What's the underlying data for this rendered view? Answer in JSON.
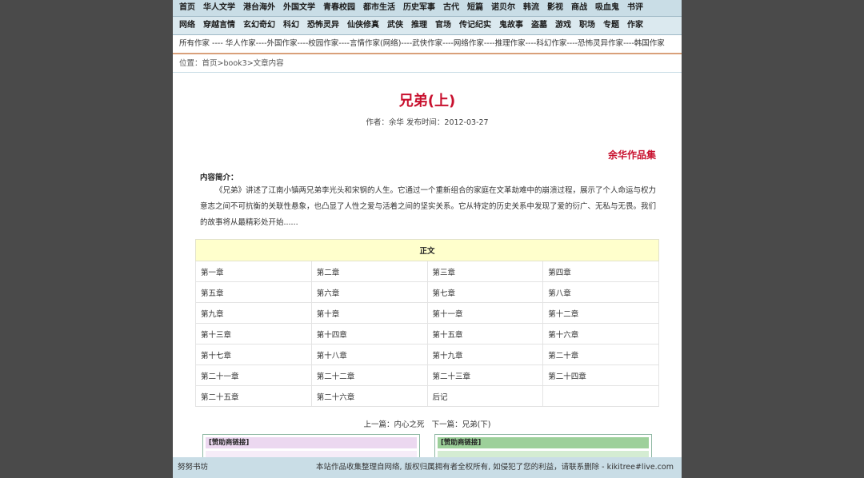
{
  "nav": {
    "row1": [
      "首页",
      "华人文学",
      "港台海外",
      "外国文学",
      "青春校园",
      "都市生活",
      "历史军事",
      "古代",
      "短篇",
      "诺贝尔",
      "韩流",
      "影视",
      "商战",
      "吸血鬼",
      "书评"
    ],
    "row2": [
      "网络",
      "穿越言情",
      "玄幻奇幻",
      "科幻",
      "恐怖灵异",
      "仙侠修真",
      "武侠",
      "推理",
      "官场",
      "传记纪实",
      "鬼故事",
      "盗墓",
      "游戏",
      "职场",
      "专题",
      "作家"
    ]
  },
  "author_links": [
    "所有作家",
    "华人作家",
    "外国作家",
    "校园作家",
    "言情作家(网络)",
    "武侠作家",
    "网络作家",
    "推理作家",
    "科幻作家",
    "恐怖灵异作家",
    "韩国作家"
  ],
  "author_separators": [
    " ---- ",
    "----",
    "----",
    "----",
    "----",
    "----",
    "----",
    "----",
    "----",
    "----"
  ],
  "breadcrumb": {
    "label": "位置：",
    "home": "首页",
    "sep1": ">",
    "book": "book3",
    "sep2": ">",
    "current": "文章内容"
  },
  "article": {
    "title": "兄弟(上)",
    "meta": "作者：余华 发布时间：2012-03-27",
    "collection": "余华作品集",
    "intro_label": "内容简介：",
    "intro_text": "《兄弟》讲述了江南小镇两兄弟李光头和宋钢的人生。它通过一个重新组合的家庭在文革劫难中的崩溃过程，展示了个人命运与权力意志之间不可抗衡的关联性悬象，也凸显了人性之爱与活着之间的坚实关系。它从特定的历史关系中发现了爱的衍广、无私与无畏。我们的故事将从最精彩处开始......"
  },
  "toc": {
    "header": "正文",
    "rows": [
      [
        "第一章",
        "第二章",
        "第三章",
        "第四章"
      ],
      [
        "第五章",
        "第六章",
        "第七章",
        "第八章"
      ],
      [
        "第九章",
        "第十章",
        "第十一章",
        "第十二章"
      ],
      [
        "第十三章",
        "第十四章",
        "第十五章",
        "第十六章"
      ],
      [
        "第十七章",
        "第十八章",
        "第十九章",
        "第二十章"
      ],
      [
        "第二十一章",
        "第二十二章",
        "第二十三章",
        "第二十四章"
      ],
      [
        "第二十五章",
        "第二十六章",
        "后记",
        ""
      ]
    ]
  },
  "prevnext": {
    "prev_label": "上一篇：",
    "prev": "内心之死",
    "next_label": "下一篇：",
    "next": "兄弟(下)"
  },
  "sponsors": {
    "left": "[赞助商链接]",
    "right": "[赞助商链接]"
  },
  "footer": {
    "left": "努努书坊",
    "right": "本站作品收集整理自网络, 版权归属拥有者全权所有, 如侵犯了您的利益，请联系删除 - kikitree#live.com"
  }
}
